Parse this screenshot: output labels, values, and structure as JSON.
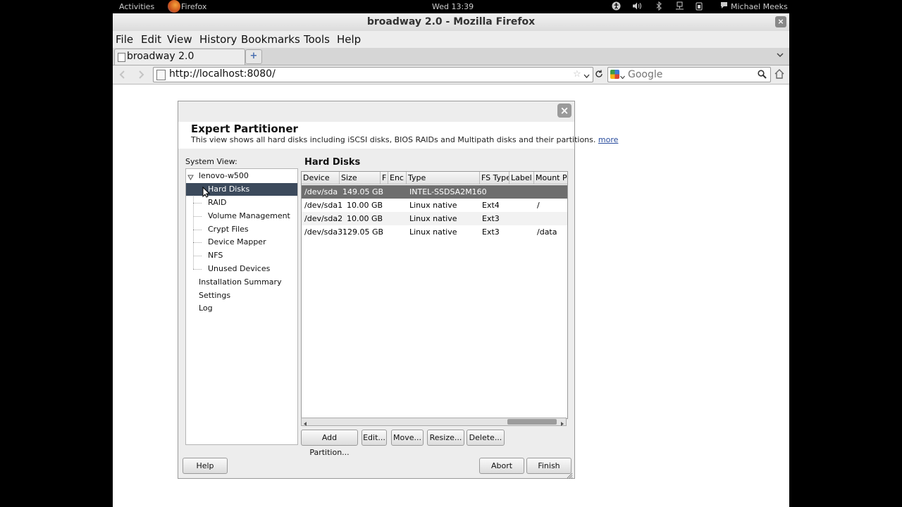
{
  "topbar": {
    "activities": "Activities",
    "app_name": "Firefox",
    "clock": "Wed 13:39",
    "user": "Michael Meeks"
  },
  "window": {
    "title": "broadway 2.0 - Mozilla Firefox",
    "close": "×"
  },
  "menu": {
    "file": "File",
    "edit": "Edit",
    "view": "View",
    "history": "History",
    "bookmarks": "Bookmarks",
    "tools": "Tools",
    "help": "Help"
  },
  "tabs": [
    {
      "label": "broadway 2.0"
    }
  ],
  "new_tab": "+",
  "url": "http://localhost:8080/",
  "search": {
    "placeholder": "Google"
  },
  "dialog": {
    "title": "Expert Partitioner",
    "description": "This view shows all hard disks including iSCSI disks, BIOS RAIDs and Multipath disks and their partitions.",
    "more_link": "more",
    "close": "×",
    "system_view_label": "System View:",
    "tree": {
      "root": "lenovo-w500",
      "children": [
        "Hard Disks",
        "RAID",
        "Volume Management",
        "Crypt Files",
        "Device Mapper",
        "NFS",
        "Unused Devices"
      ],
      "top_items": [
        "Installation Summary",
        "Settings",
        "Log"
      ]
    },
    "section_title": "Hard Disks",
    "columns": [
      "Device",
      "Size",
      "F",
      "Enc",
      "Type",
      "FS Type",
      "Label",
      "Mount Po"
    ],
    "rows": [
      {
        "device": "/dev/sda",
        "size": "149.05 GB",
        "f": "",
        "enc": "",
        "type": "INTEL-SSDSA2M160",
        "fstype": "",
        "label": "",
        "mount": ""
      },
      {
        "device": "/dev/sda1",
        "size": "10.00 GB",
        "f": "",
        "enc": "",
        "type": "Linux native",
        "fstype": "Ext4",
        "label": "",
        "mount": "/"
      },
      {
        "device": "/dev/sda2",
        "size": "10.00 GB",
        "f": "",
        "enc": "",
        "type": "Linux native",
        "fstype": "Ext3",
        "label": "",
        "mount": ""
      },
      {
        "device": "/dev/sda3",
        "size": "129.05 GB",
        "f": "",
        "enc": "",
        "type": "Linux native",
        "fstype": "Ext3",
        "label": "",
        "mount": "/data"
      }
    ],
    "buttons": {
      "add_partition": "Add Partition...",
      "edit": "Edit...",
      "move": "Move...",
      "resize": "Resize...",
      "delete": "Delete...",
      "help": "Help",
      "abort": "Abort",
      "finish": "Finish"
    }
  },
  "colors": {
    "selection": "#3c4a5c",
    "row_selected": "#6e6e6e",
    "link": "#2a4d9e"
  }
}
